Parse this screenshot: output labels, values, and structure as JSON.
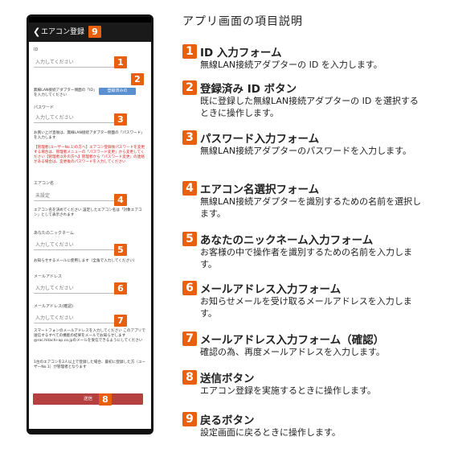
{
  "phone": {
    "title": "エアコン登録",
    "back_icon": "chevron-left-icon",
    "id_label": "ID",
    "id_placeholder": "入力してください",
    "registered_id_button": "登録済みの",
    "id_note": "無線LAN接続アダプター側面の「ID」を入力してください",
    "password_label": "パスワード",
    "password_placeholder": "入力してください",
    "password_note": "お買い上げ直後は、無線LAN接続アダプター側面の「パスワード」を入力します",
    "admin_note_red": "【管理者(ユーザーNo.1)の方へ】エアコン登録後パスワードを変更する場合は、管理者メニューの「パスワード変更」から変更してください【管理者以外の方へ】管理者から「パスワード変更」の連絡がある場合は、変更後のパスワードを入力してください",
    "aircon_label": "エアコン名",
    "aircon_value": "未設定",
    "aircon_note": "エアコン名を決めてください 設定したエアコン名は「対象エアコン」として表示されます",
    "nickname_label": "あなたのニックネーム",
    "nickname_placeholder": "入力してください",
    "nickname_note": "お知らせするメールに使用します（全角で入力してください）",
    "email_label": "メールアドレス",
    "email_placeholder": "入力してください",
    "email_confirm_label": "メールアドレス(確認)",
    "email_confirm_placeholder": "入力してください",
    "email_note": "スマートフォンのメールアドレスを入力してください このアプリで送信するすべての機能の結果をメールでお知らせします @rac.hitachi-ap.co.jpのメールを受信できるようにしてください",
    "first_user_note": "1台のエアコンを2人以上で登録した場合、最初に登録した方（ユーザーNo.1）が管理者となります",
    "send_button": "送信"
  },
  "badges": [
    "1",
    "2",
    "3",
    "4",
    "5",
    "6",
    "7",
    "8",
    "9"
  ],
  "heading": "アプリ画面の項目説明",
  "items": [
    {
      "num": "1",
      "title": "ID 入力フォーム",
      "desc": "無線LAN接続アダプターの ID を入力します。"
    },
    {
      "num": "2",
      "title": "登録済み ID ボタン",
      "desc": "既に登録した無線LAN接続アダプターの ID を選択するときに操作します。"
    },
    {
      "num": "3",
      "title": "パスワード入力フォーム",
      "desc": "無線LAN接続アダプターのパスワードを入力します。"
    },
    {
      "num": "4",
      "title": "エアコン名選択フォーム",
      "desc": "無線LAN接続アダプターを識別するための名前を選択します。"
    },
    {
      "num": "5",
      "title": "あなたのニックネーム入力フォーム",
      "desc": "お客様の中で操作者を識別するための名前を入力します。"
    },
    {
      "num": "6",
      "title": "メールアドレス入力フォーム",
      "desc": "お知らせメールを受け取るメールアドレスを入力します。"
    },
    {
      "num": "7",
      "title": "メールアドレス入力フォーム（確認）",
      "desc": "確認の為、再度メールアドレスを入力します。"
    },
    {
      "num": "8",
      "title": "送信ボタン",
      "desc": "エアコン登録を実施するときに操作します。"
    },
    {
      "num": "9",
      "title": "戻るボタン",
      "desc": "設定画面に戻るときに操作します。"
    }
  ]
}
